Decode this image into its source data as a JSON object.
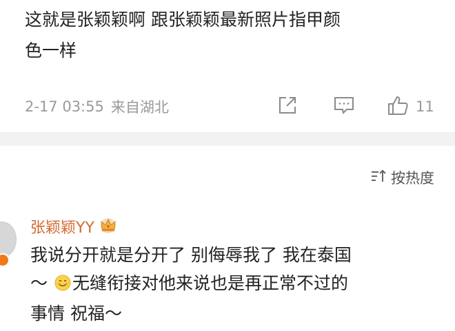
{
  "post": {
    "line1": "这就是张颖颖啊 跟张颖颖最新照片指甲颜",
    "line2": "色一样",
    "timestamp": "2-17 03:55",
    "location": "来自湖北",
    "like_count": "11",
    "icons": [
      "share-icon",
      "comment-icon",
      "thumbs-up-icon"
    ]
  },
  "comments_header": {
    "sort_label": "按热度",
    "sort_icon": "sort-icon"
  },
  "reply": {
    "username": "张颖颖YY",
    "badge_icon": "crown-icon",
    "line1": "我说分开就是分开了 别侮辱我了 我在泰国",
    "line2_prefix": "～",
    "emoji": "smile-emoji",
    "line2_rest": "无缝衔接对他来说也是再正常不过的",
    "line3": "事情 祝福～"
  },
  "colors": {
    "username": "#d56a33",
    "meta_gray": "#9a9a9a",
    "divider": "#f2f2f2",
    "verified_badge": "#f07a1a"
  }
}
